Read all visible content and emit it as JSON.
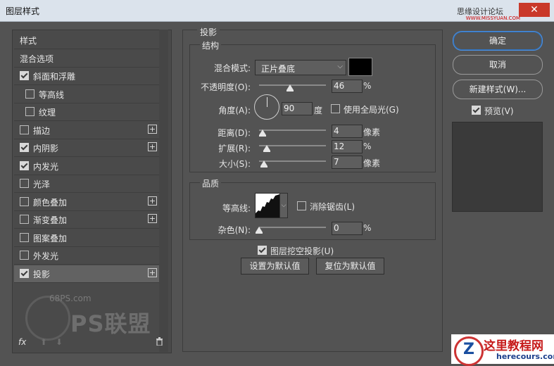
{
  "window": {
    "title": "图层样式",
    "site": "思缘设计论坛",
    "site_watermark": "WWW.MISSYUAN.COM",
    "close_glyph": "✕"
  },
  "sidebar": {
    "items": [
      {
        "label": "样式",
        "checkbox": null,
        "plus": false,
        "indent": 0
      },
      {
        "label": "混合选项",
        "checkbox": null,
        "plus": false,
        "indent": 0
      },
      {
        "label": "斜面和浮雕",
        "checkbox": true,
        "plus": false,
        "indent": 0
      },
      {
        "label": "等高线",
        "checkbox": false,
        "plus": false,
        "indent": 1
      },
      {
        "label": "纹理",
        "checkbox": false,
        "plus": false,
        "indent": 1
      },
      {
        "label": "描边",
        "checkbox": false,
        "plus": true,
        "indent": 0
      },
      {
        "label": "内阴影",
        "checkbox": true,
        "plus": true,
        "indent": 0
      },
      {
        "label": "内发光",
        "checkbox": true,
        "plus": false,
        "indent": 0
      },
      {
        "label": "光泽",
        "checkbox": false,
        "plus": false,
        "indent": 0
      },
      {
        "label": "颜色叠加",
        "checkbox": false,
        "plus": true,
        "indent": 0
      },
      {
        "label": "渐变叠加",
        "checkbox": false,
        "plus": true,
        "indent": 0
      },
      {
        "label": "图案叠加",
        "checkbox": false,
        "plus": false,
        "indent": 0
      },
      {
        "label": "外发光",
        "checkbox": false,
        "plus": false,
        "indent": 0
      },
      {
        "label": "投影",
        "checkbox": true,
        "plus": true,
        "indent": 0,
        "selected": true
      }
    ],
    "watermark_top": "68PS.com",
    "watermark_brand": "PS联盟",
    "fx_label": "fx",
    "icons": {
      "up": "arrow-up-icon",
      "down": "arrow-down-icon",
      "trash": "trash-icon"
    }
  },
  "panel": {
    "section_title": "投影",
    "structure": {
      "title": "结构",
      "blend_mode_label": "混合模式:",
      "blend_mode_value": "正片叠底",
      "shadow_color": "#000000",
      "opacity_label": "不透明度(O):",
      "opacity_value": "46",
      "opacity_unit": "%",
      "opacity_fraction": 0.46,
      "angle_label": "角度(A):",
      "angle_value": "90",
      "angle_unit": "度",
      "global_light_label": "使用全局光(G)",
      "global_light_checked": false,
      "distance_label": "距离(D):",
      "distance_value": "4",
      "distance_unit": "像素",
      "spread_label": "扩展(R):",
      "spread_value": "12",
      "spread_unit": "%",
      "size_label": "大小(S):",
      "size_value": "7",
      "size_unit": "像素"
    },
    "quality": {
      "title": "品质",
      "contour_label": "等高线:",
      "antialias_label": "消除锯齿(L)",
      "antialias_checked": false,
      "noise_label": "杂色(N):",
      "noise_value": "0",
      "noise_unit": "%"
    },
    "knockout_label": "图层挖空投影(U)",
    "knockout_checked": true,
    "set_default": "设置为默认值",
    "reset_default": "复位为默认值"
  },
  "actions": {
    "ok": "确定",
    "cancel": "取消",
    "new_style": "新建样式(W)...",
    "preview_label": "预览(V)",
    "preview_checked": true
  },
  "watermark": {
    "title": "这里教程网",
    "url": "herecours.com",
    "logo_letter": "Z"
  }
}
